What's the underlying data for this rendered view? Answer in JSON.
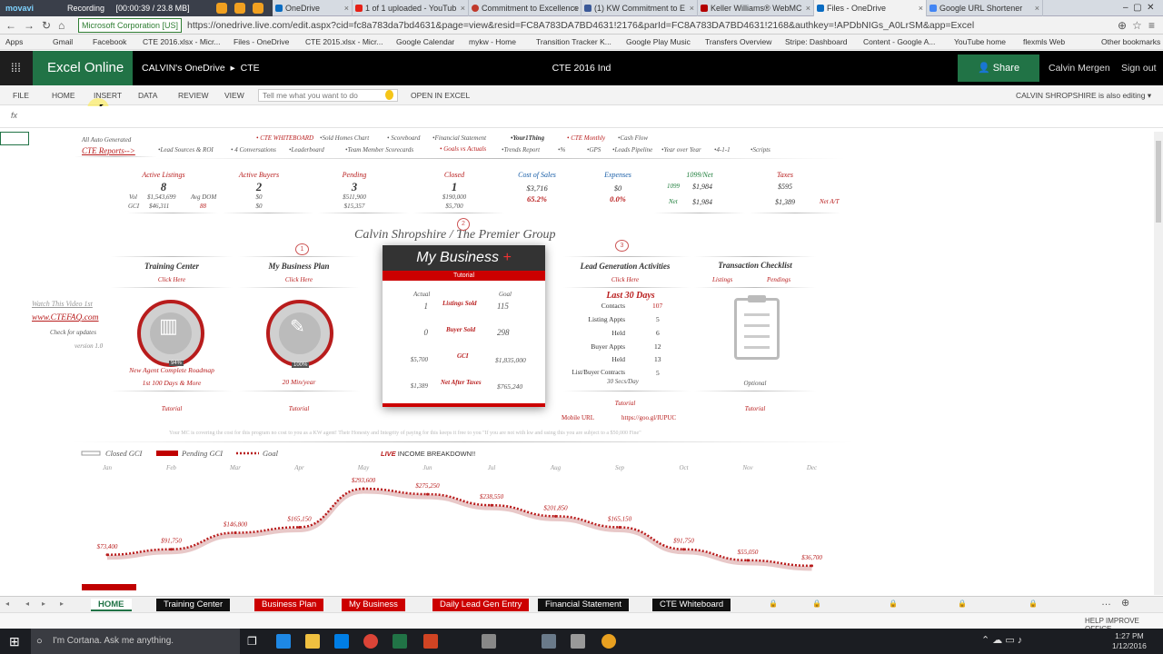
{
  "recorder": {
    "brand": "movavi",
    "status": "Recording",
    "time": "[00:00:39 / 23.8 MB]"
  },
  "browser": {
    "tabs": [
      "OneDrive",
      "1 of 1 uploaded - YouTub",
      "Commitment to Excellence",
      "(1) KW Commitment to E",
      "Keller Williams® WebMC",
      "Files - OneDrive",
      "Google URL Shortener"
    ],
    "secure_label": "Microsoft Corporation [US]",
    "url": "https://onedrive.live.com/edit.aspx?cid=fc8a783da7bd4631&page=view&resid=FC8A783DA7BD4631!2176&parId=FC8A783DA7BD4631!2168&authkey=!APDbNIGs_A0LrSM&app=Excel",
    "bookmarks": [
      "Apps",
      "Gmail",
      "Facebook",
      "CTE 2016.xlsx - Micr...",
      "Files - OneDrive",
      "CTE 2015.xlsx - Micr...",
      "Google Calendar",
      "mykw - Home",
      "Transition Tracker K...",
      "Google Play Music",
      "Transfers Overview",
      "Stripe: Dashboard",
      "Content - Google A...",
      "YouTube home",
      "flexmls Web",
      "Other bookmarks"
    ]
  },
  "excel": {
    "brand": "Excel Online",
    "owner": "CALVIN's OneDrive",
    "sep": "▸",
    "folder": "CTE",
    "doc_title": "CTE 2016 Ind",
    "share": "Share",
    "user": "Calvin Mergen",
    "signout": "Sign out",
    "ribbon": [
      "FILE",
      "HOME",
      "INSERT",
      "DATA",
      "REVIEW",
      "VIEW"
    ],
    "tell_me": "Tell me what you want to do",
    "open_in": "OPEN IN EXCEL",
    "editing": "CALVIN SHROPSHIRE is also editing ▾",
    "fx": "fx"
  },
  "sheet": {
    "auto_gen": "All Auto Generated",
    "reports": "CTE Reports-->",
    "nav_row1": [
      "• CTE WHITEBOARD",
      "•Sold Homes Chart",
      "• Scoreboard",
      "•Financial Statement",
      "•Your1Thing",
      "• CTE Monthly",
      "•Cash Flow"
    ],
    "nav_row2": [
      "•Lead Sources & ROI",
      "• 4 Conversations",
      "•Leaderboard",
      "•Team Member Scorecards",
      "• Goals vs Actuals",
      "•Trends Report",
      "•%",
      "•GPS",
      "•Leads Pipeline",
      "•Year over Year",
      "•4-1-1",
      "•Scripts"
    ],
    "stats": {
      "active_listings": {
        "label": "Active Listings",
        "value": "8"
      },
      "vol_label": "Vol",
      "vol": "$1,543,699",
      "gci_label": "GCI",
      "gci": "$46,311",
      "avg_dom_label": "Avg DOM",
      "avg_dom": "88",
      "active_buyers": {
        "label": "Active Buyers",
        "value": "2",
        "a": "$0",
        "b": "$0"
      },
      "pending": {
        "label": "Pending",
        "value": "3",
        "a": "$511,900",
        "b": "$15,357"
      },
      "closed": {
        "label": "Closed",
        "value": "1",
        "a": "$190,000",
        "b": "$5,700"
      },
      "cost_of_sales": {
        "label": "Cost of Sales",
        "a": "$3,716",
        "b": "65.2%"
      },
      "expenses": {
        "label": "Expenses",
        "a": "$0",
        "b": "0.0%"
      },
      "net1099": {
        "label": "1099/Net",
        "l1": "1099",
        "v1": "$1,984",
        "l2": "Net",
        "v2": "$1,984"
      },
      "taxes": {
        "label": "Taxes",
        "a": "$595",
        "b": "$1,389"
      },
      "net_at": "Net A/T"
    },
    "title": "Calvin Shropshire / The Premier Group",
    "step_numbers": [
      "1",
      "2",
      "3"
    ],
    "training": {
      "title": "Training Center",
      "link": "Click Here",
      "pct": "94%",
      "caption1": "New Agent Complete Roadmap",
      "caption2": "1st 100 Days & More",
      "tutorial": "Tutorial"
    },
    "plan": {
      "title": "My Business Plan",
      "link": "Click Here",
      "pct": "100%",
      "caption": "20 Min/year",
      "tutorial": "Tutorial"
    },
    "watch": "Watch This Video 1st",
    "site": "www.CTEFAQ.com",
    "check": "Check for updates",
    "version": "version 1.0",
    "mybusiness": {
      "title": "My Business",
      "plus": "+",
      "tutorial": "Tutorial",
      "actual": "Actual",
      "goal": "Goal",
      "rows": [
        {
          "a": "1",
          "label": "Listings Sold",
          "g": "115"
        },
        {
          "a": "0",
          "label": "Buyer Sold",
          "g": "298"
        },
        {
          "a": "$5,700",
          "label": "GCI",
          "g": "$1,835,000"
        },
        {
          "a": "$1,389",
          "label": "Net After Taxes",
          "g": "$765,240"
        }
      ]
    },
    "leadgen": {
      "title": "Lead Generation Activities",
      "link": "Click Here",
      "period": "Last 30 Days",
      "rows": [
        {
          "l": "Contacts",
          "v": "107"
        },
        {
          "l": "Listing Appts",
          "v": "5"
        },
        {
          "l": "Held",
          "v": "6"
        },
        {
          "l": "Buyer Appts",
          "v": "12"
        },
        {
          "l": "Held",
          "v": "13"
        },
        {
          "l": "List/Buyer Contracts",
          "v": "5"
        }
      ],
      "secs": "30 Secs/Day",
      "tutorial": "Tutorial",
      "mobile": "Mobile URL",
      "short": "https://goo.gl/IUPUC"
    },
    "checklist": {
      "title": "Transaction Checklist",
      "listings": "Listings",
      "pendings": "Pendings",
      "optional": "Optional",
      "tutorial": "Tutorial"
    },
    "disclaimer": "Your MC is covering the cost for this program no cost to you as a KW agent! Their Honesty and Integrity of paying for this keeps it free to you \"If you are not with kw and using this you are subject to a $50,000 Fine\""
  },
  "chart_data": {
    "type": "line",
    "title": "LIVE INCOME BREAKDOWN!!",
    "legend": [
      "Closed GCI",
      "Pending GCI",
      "Goal"
    ],
    "categories": [
      "Jan",
      "Feb",
      "Mar",
      "Apr",
      "May",
      "Jun",
      "Jul",
      "Aug",
      "Sep",
      "Oct",
      "Nov",
      "Dec"
    ],
    "series": [
      {
        "name": "Goal",
        "values": [
          73400,
          91750,
          146800,
          165150,
          293600,
          275250,
          238550,
          201850,
          165150,
          91750,
          55050,
          36700
        ]
      }
    ],
    "data_labels": [
      "$73,400",
      "$91,750",
      "$146,800",
      "$165,150",
      "$293,600",
      "$275,250",
      "$238,550",
      "$201,850",
      "$165,150",
      "$91,750",
      "$55,050",
      "$36,700"
    ],
    "colors": {
      "goal": "#b81c1c",
      "pending": "#c00000"
    }
  },
  "sheet_tabs": [
    "HOME",
    "Training Center",
    "Business Plan",
    "My Business",
    "Daily Lead Gen Entry",
    "Financial Statement",
    "CTE Whiteboard"
  ],
  "status": {
    "help": "HELP IMPROVE OFFICE"
  },
  "taskbar": {
    "cortana": "I'm Cortana. Ask me anything.",
    "time": "1:27 PM",
    "date": "1/12/2016"
  }
}
